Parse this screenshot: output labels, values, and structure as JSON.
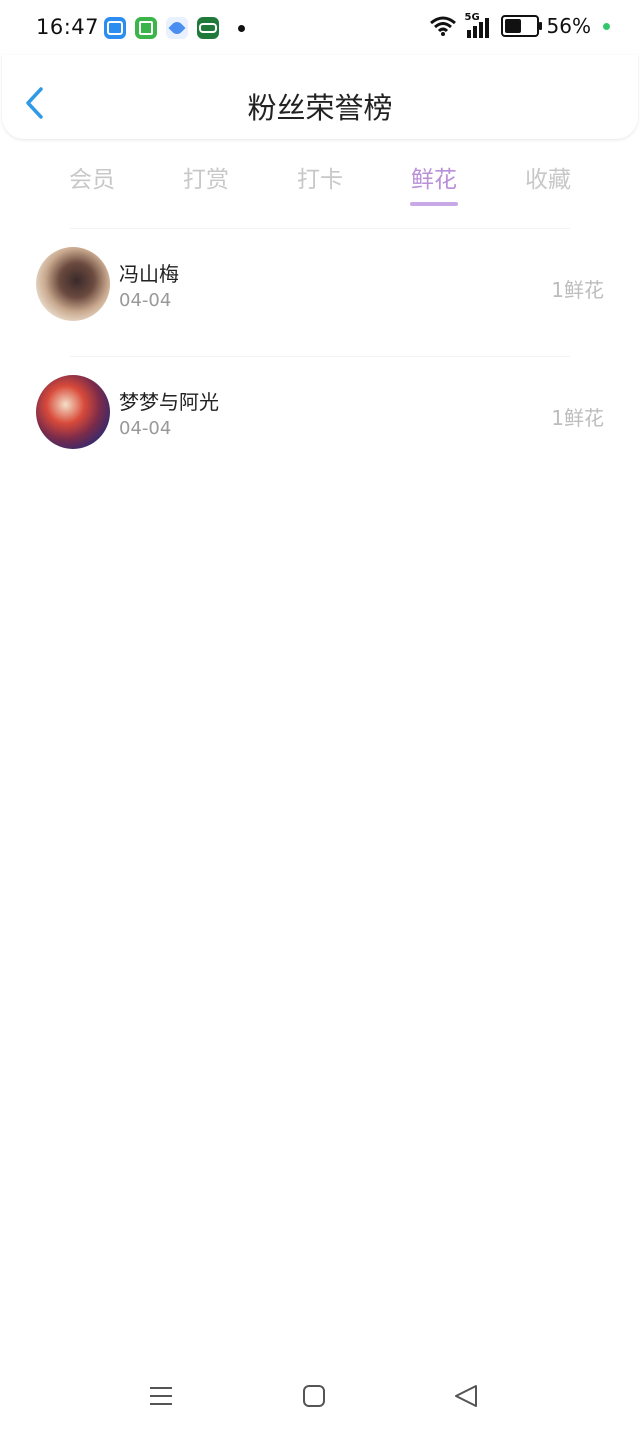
{
  "status": {
    "time": "16:47",
    "battery_percent": "56%",
    "network": "5G"
  },
  "header": {
    "title": "粉丝荣誉榜"
  },
  "tabs": [
    {
      "label": "会员",
      "active": false
    },
    {
      "label": "打赏",
      "active": false
    },
    {
      "label": "打卡",
      "active": false
    },
    {
      "label": "鲜花",
      "active": true
    },
    {
      "label": "收藏",
      "active": false
    }
  ],
  "list": [
    {
      "name": "冯山梅",
      "date": "04-04",
      "amount": "1鲜花"
    },
    {
      "name": "梦梦与阿光",
      "date": "04-04",
      "amount": "1鲜花"
    }
  ],
  "colors": {
    "accent": "#b98fd8",
    "back_arrow": "#2f9be6"
  }
}
